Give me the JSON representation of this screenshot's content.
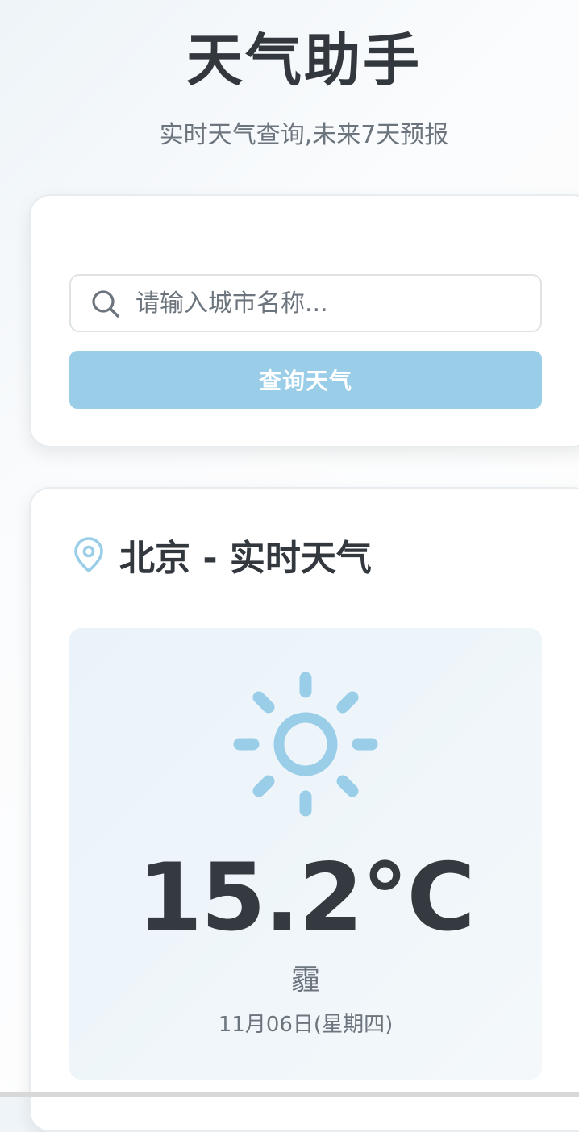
{
  "header": {
    "title": "天气助手",
    "subtitle": "实时天气查询,未来7天预报"
  },
  "search": {
    "placeholder": "请输入城市名称...",
    "value": "",
    "button_label": "查询天气",
    "icon": "search-icon"
  },
  "weather": {
    "location_icon": "map-pin-icon",
    "title": "北京 - 实时天气",
    "condition_icon": "sun-icon",
    "temperature": "15.2°C",
    "condition": "霾",
    "date": "11月06日(星期四)"
  },
  "colors": {
    "accent": "#99cde8",
    "title_text": "#32383d",
    "muted_text": "#6c757d",
    "panel_bg": "#eef5fa"
  }
}
